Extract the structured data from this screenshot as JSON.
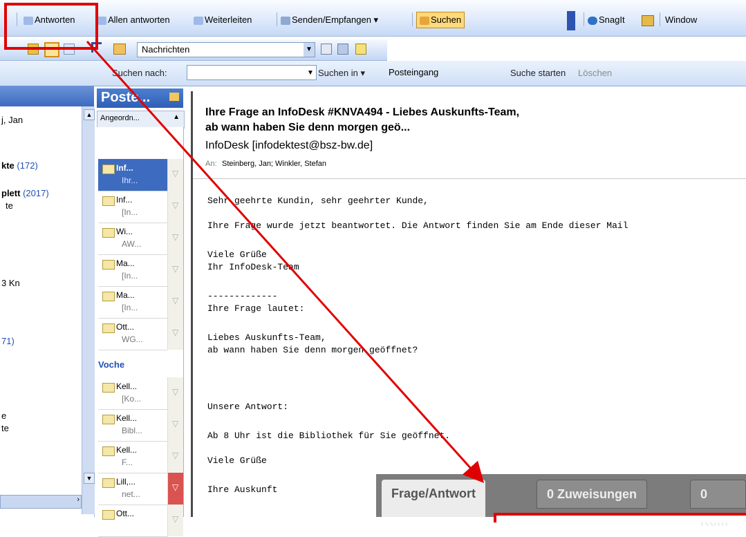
{
  "toolbar": {
    "reply": "Antworten",
    "reply_all": "Allen antworten",
    "forward": "Weiterleiten",
    "send_receive": "Senden/Empfangen",
    "find": "Suchen",
    "snagit": "SnagIt",
    "window": "Window"
  },
  "toolbar2": {
    "view_select": "Nachrichten"
  },
  "searchbar": {
    "search_for_label": "Suchen nach:",
    "search_for_value": "",
    "search_in_label": "Suchen in",
    "search_in_value": "Posteingang",
    "start": "Suche starten",
    "clear": "Löschen"
  },
  "nav": {
    "items": [
      {
        "label": "j, Jan",
        "count": ""
      },
      {
        "label": "kte",
        "count": "(172)"
      },
      {
        "label": "plett",
        "count": "(2017)"
      },
      {
        "label": "te",
        "count": ""
      },
      {
        "label": "3 Kn",
        "count": ""
      },
      {
        "label": "71)",
        "count": ""
      },
      {
        "label": "e",
        "count": ""
      },
      {
        "label": "te",
        "count": ""
      }
    ]
  },
  "mail_list": {
    "title": "Poste...",
    "arranged_by": "Angeordn...",
    "group_week": "Voche",
    "items": [
      {
        "from": "Inf...",
        "subject": "Ihr..."
      },
      {
        "from": "Inf...",
        "subject": "[In..."
      },
      {
        "from": "Wi...",
        "subject": "AW..."
      },
      {
        "from": "Ma...",
        "subject": "[In..."
      },
      {
        "from": "Ma...",
        "subject": "[In..."
      },
      {
        "from": "Ott...",
        "subject": "WG..."
      },
      {
        "from": "Kell...",
        "subject": "[Ko..."
      },
      {
        "from": "Kell...",
        "subject": "Bibl..."
      },
      {
        "from": "Kell...",
        "subject": "F..."
      },
      {
        "from": "Lill,...",
        "subject": "net..."
      },
      {
        "from": "Ott...",
        "subject": ""
      }
    ]
  },
  "message": {
    "subject_line1": "Ihre Frage an InfoDesk #KNVA494  - Liebes Auskunfts-Team,",
    "subject_line2": "ab wann haben Sie denn morgen geö...",
    "sender": "InfoDesk [infodektest@bsz-bw.de]",
    "to_label": "An:",
    "to": "Steinberg, Jan; Winkler, Stefan",
    "body": [
      "Sehr geehrte Kundin, sehr geehrter Kunde,",
      "Ihre Frage wurde jetzt beantwortet. Die Antwort finden Sie am Ende dieser Mail",
      "Viele Grüße",
      "Ihr InfoDesk-Team",
      "-------------",
      "Ihre Frage lautet:",
      "Liebes Auskunfts-Team,",
      "ab wann haben Sie denn morgen geöffnet?",
      "Unsere Antwort:",
      "Ab 8 Uhr ist die Bibliothek für Sie geöffnet.",
      "Viele Grüße",
      "Ihre Auskunft"
    ]
  },
  "overlay_tabs": {
    "tab1": "Frage/Antwort",
    "tab2": "0 Zuweisungen",
    "tab3": "0 Kom"
  },
  "colors": {
    "annotation_red": "#e00000",
    "toolbar_blue": "#c6d9f5",
    "header_blue": "#3d6bc0"
  }
}
